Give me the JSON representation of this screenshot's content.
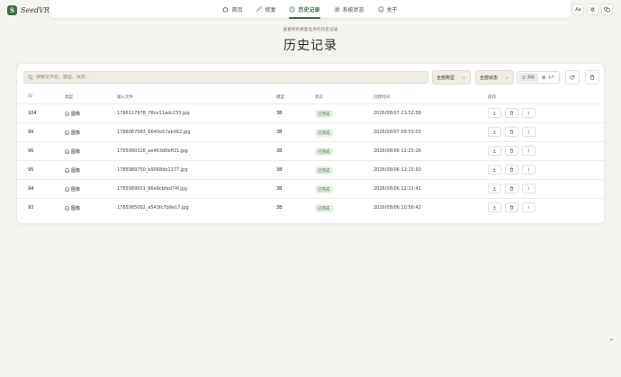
{
  "app": {
    "logo_letter": "S",
    "name": "SeedVR2"
  },
  "nav": [
    {
      "label": "首页",
      "icon": "home-icon"
    },
    {
      "label": "修复",
      "icon": "magic-wand-icon"
    },
    {
      "label": "历史记录",
      "icon": "history-icon"
    },
    {
      "label": "系统状态",
      "icon": "gear-icon"
    },
    {
      "label": "关于",
      "icon": "info-icon"
    }
  ],
  "active_nav": "历史记录",
  "topbar": {
    "font_label": "Aa"
  },
  "header": {
    "subtitle": "查看所有修复任务的历史记录",
    "title": "历史记录"
  },
  "toolbar": {
    "search_placeholder": "搜索文件名、模型、状态...",
    "type_filter": "全部类型",
    "status_filter": "全部状态",
    "view_list": "表格",
    "view_grid": "卡片"
  },
  "table": {
    "headers": [
      "ID",
      "类型",
      "输入文件",
      "模型",
      "状态",
      "创建时间",
      "操作"
    ],
    "rows": [
      {
        "id": "104",
        "type": "图像",
        "file": "1786117978_78ce11adc233.jpg",
        "model": "3B",
        "status": "已完成",
        "time": "2026/08/07 23:52:58"
      },
      {
        "id": "99",
        "type": "图像",
        "file": "1786067583_6640e57eb462.jpg",
        "model": "3B",
        "status": "已完成",
        "time": "2026/08/07 09:53:03"
      },
      {
        "id": "96",
        "type": "图像",
        "file": "1785990326_ae463d0bff21.jpg",
        "model": "3B",
        "status": "已完成",
        "time": "2026/08/06 12:25:26"
      },
      {
        "id": "95",
        "type": "图像",
        "file": "1785989750_b9068de1177.jpg",
        "model": "3B",
        "status": "已完成",
        "time": "2026/08/06 12:15:50"
      },
      {
        "id": "94",
        "type": "图像",
        "file": "1785989501_86e8cbfed74f.jpg",
        "model": "3B",
        "status": "已完成",
        "time": "2026/08/06 12:11:41"
      },
      {
        "id": "93",
        "type": "图像",
        "file": "1785985002_a543fc7b9e17.jpg",
        "model": "3B",
        "status": "已完成",
        "time": "2026/08/06 10:56:42"
      }
    ]
  },
  "colors": {
    "accent": "#3d6b45",
    "status_bg": "#e9f0e6",
    "background": "#f5f4f0"
  }
}
